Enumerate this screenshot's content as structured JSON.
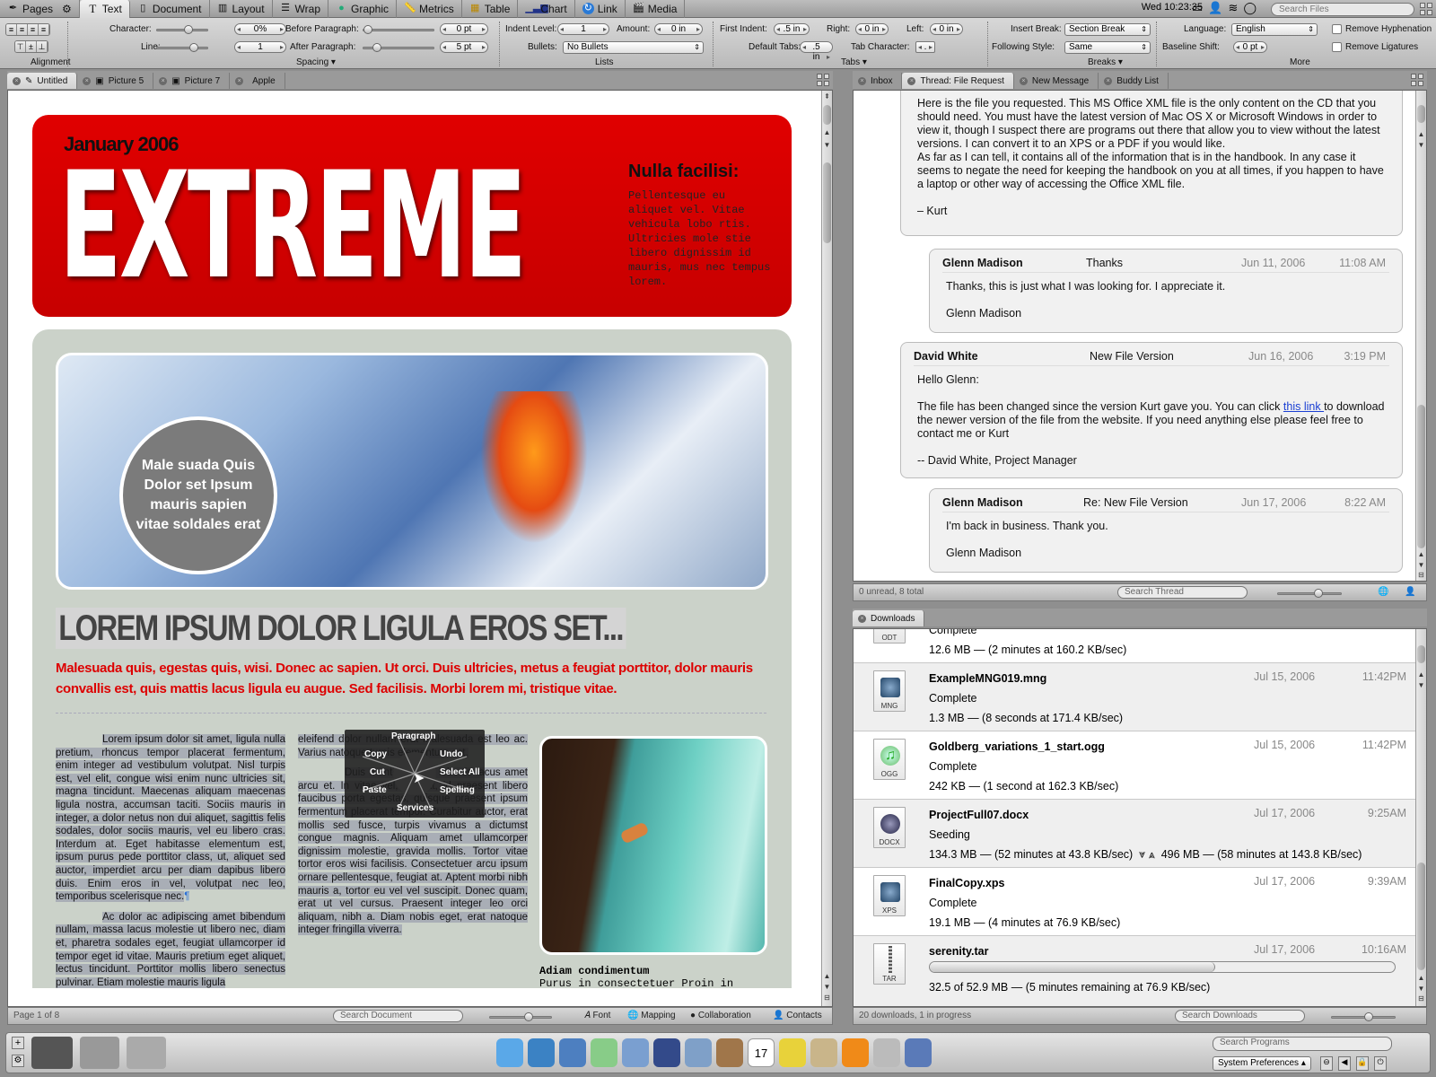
{
  "menubar": {
    "app_name": "Pages",
    "tabs": [
      {
        "label": "Text",
        "icon": "text-icon",
        "active": true
      },
      {
        "label": "Document",
        "icon": "document-icon"
      },
      {
        "label": "Layout",
        "icon": "layout-icon"
      },
      {
        "label": "Wrap",
        "icon": "wrap-icon"
      },
      {
        "label": "Graphic",
        "icon": "graphic-icon"
      },
      {
        "label": "Metrics",
        "icon": "ruler-icon"
      },
      {
        "label": "Table",
        "icon": "table-icon"
      },
      {
        "label": "Chart",
        "icon": "chart-icon"
      },
      {
        "label": "Link",
        "icon": "link-icon"
      },
      {
        "label": "Media",
        "icon": "media-icon"
      }
    ],
    "clock": "Wed 10:23:35",
    "search_placeholder": "Search Files"
  },
  "toolbar": {
    "alignment_label": "Alignment",
    "spacing_label": "Spacing",
    "lists_label": "Lists",
    "tabs_label": "Tabs",
    "breaks_label": "Breaks",
    "more_label": "More",
    "character_label": "Character:",
    "character_value": "0%",
    "line_label": "Line:",
    "line_value": "1",
    "before_paragraph_label": "Before Paragraph:",
    "before_paragraph_value": "0 pt",
    "after_paragraph_label": "After Paragraph:",
    "after_paragraph_value": "5 pt",
    "indent_level_label": "Indent Level:",
    "indent_level_value": "1",
    "amount_label": "Amount:",
    "amount_value": "0 in",
    "bullets_label": "Bullets:",
    "bullets_value": "No Bullets",
    "first_indent_label": "First Indent:",
    "first_indent_value": ".5 in",
    "right_label": "Right:",
    "right_value": "0 in",
    "left_label": "Left:",
    "left_value": "0 in",
    "default_tabs_label": "Default Tabs:",
    "default_tabs_value": ".5 in",
    "tab_character_label": "Tab Character:",
    "tab_character_value": ".",
    "insert_break_label": "Insert Break:",
    "insert_break_value": "Section Break",
    "following_style_label": "Following Style:",
    "following_style_value": "Same",
    "language_label": "Language:",
    "language_value": "English",
    "baseline_shift_label": "Baseline Shift:",
    "baseline_shift_value": "0 pt",
    "remove_hyphenation_label": "Remove Hyphenation",
    "remove_ligatures_label": "Remove Ligatures"
  },
  "doc_tabs": [
    {
      "label": "Untitled",
      "active": true
    },
    {
      "label": "Picture 5"
    },
    {
      "label": "Picture 7"
    },
    {
      "label": "Apple"
    }
  ],
  "mail_tabs": [
    {
      "label": "Inbox"
    },
    {
      "label": "Thread: File Request",
      "active": true
    },
    {
      "label": "New Message"
    },
    {
      "label": "Buddy List"
    }
  ],
  "downloads_tab": {
    "label": "Downloads"
  },
  "document": {
    "date": "January 2006",
    "masthead": "EXTREME",
    "sidebar_title": "Nulla facilisi:",
    "sidebar_text": "Pellentesque eu aliquet vel. Vitae vehicula lobo rtis. Ultricies mole stie libero dignissim id mauris, mus nec tempus lorem.",
    "circle_text": "Male suada Quis Dolor set Ipsum mauris sapien vitae soldales erat",
    "headline": "LOREM IPSUM DOLOR LIGULA EROS SET...",
    "subhead": "Malesuada quis, egestas quis, wisi. Donec ac sapien. Ut orci. Duis ultricies, metus a feugiat porttitor, dolor mauris convallis est, quis mattis lacus ligula eu augue. Sed facilisis. Morbi lorem mi, tristique vitae.",
    "col1_p1": "Lorem ipsum dolor sit amet, ligula nulla pretium, rhoncus tempor placerat fermentum, enim integer ad vestibulum volutpat. Nisl turpis est, vel elit, congue wisi enim nunc ultricies sit, magna tincidunt. Maecenas aliquam maecenas ligula nostra, accumsan taciti. Sociis mauris in integer, a dolor netus non dui aliquet, sagittis felis sodales, dolor sociis mauris, vel eu libero cras. Interdum at. Eget habitasse elementum est, ipsum purus pede porttitor class, ut, aliquet sed auctor, imperdiet arcu per diam dapibus libero duis. Enim eros in vel, volutpat nec leo, temporibus scelerisque nec.",
    "col1_p2": "Ac dolor ac adipiscing amet bibendum nullam, massa lacus molestie ut libero nec, diam et, pharetra sodales eget, feugiat ullamcorper id tempor eget id vitae. Mauris pretium eget aliquet, lectus tincidunt. Porttitor mollis libero senectus pulvinar. Etiam molestie mauris ligula",
    "col2_p1": "eleifend dolor nullam erat malesuada est leo ac. Varius natoque turpis elementum est.",
    "col2_p2": "Duis montes, tellus lobortis lacus amet arcu et. In vitae vel, wisi at, id praesent libero faucibus porta egestas, quisque praesent ipsum fermentum placerat tempor. Curabitur auctor, erat mollis sed fusce, turpis vivamus a dictumst congue magnis. Aliquam amet ullamcorper dignissim molestie, gravida mollis. Tortor vitae tortor eros wisi facilisis. Consectetuer arcu ipsum ornare pellentesque, feugiat at. Aptent morbi nibh mauris a, tortor eu vel vel suscipit. Donec quam, erat ut vel cursus. Praesent integer leo orci aliquam, nibh a. Diam nobis eget, erat natoque integer fringilla viverra.",
    "caption_title": "Adiam condimentum",
    "caption_text": "Purus in consectetuer Proin in",
    "pilcrow": "¶"
  },
  "pie_menu": {
    "top": "Paragraph",
    "left": [
      "Copy",
      "Cut",
      "Paste"
    ],
    "right": [
      "Undo",
      "Select All",
      "Spelling"
    ],
    "bottom": "Services"
  },
  "doc_status": {
    "page_info": "Page 1 of 8",
    "search_placeholder": "Search Document",
    "font_label": "Font",
    "mapping_label": "Mapping",
    "collaboration_label": "Collaboration",
    "contacts_label": "Contacts"
  },
  "mail": {
    "messages": [
      {
        "body_p1": "Here is the file you requested. This MS Office XML file  is the only content on the CD that you should need. You must have the latest version of Mac OS X or Microsoft Windows in order to view it, though I suspect there are programs out there that allow you to view without the latest versions. I can convert it to an XPS or a PDF if you would like.",
        "body_p2": "As far as I can tell, it contains all of the information that is in the handbook. In any case it seems to negate the need for keeping the handbook on you at all times, if you happen to have a laptop or other way of accessing the Office XML file.",
        "signature": "– Kurt"
      },
      {
        "from": "Glenn Madison",
        "subject": "Thanks",
        "date": "Jun 11, 2006",
        "time": "11:08 AM",
        "body": "Thanks, this is just what I was looking for. I appreciate it.",
        "signature": "Glenn Madison"
      },
      {
        "from": "David White",
        "subject": "New File Version",
        "date": "Jun 16, 2006",
        "time": "3:19 PM",
        "greeting": "Hello Glenn:",
        "body_before_link": "The file has been changed since the version Kurt gave you. You can click ",
        "link_text": "this link ",
        "body_after_link": "to download the newer version of the file from the website. If you need anything else please feel free to contact me or Kurt",
        "signature": "-- David White, Project Manager"
      },
      {
        "from": "Glenn Madison",
        "subject": "Re: New File Version",
        "date": "Jun 17, 2006",
        "time": "8:22 AM",
        "body": "I'm back in business.  Thank you.",
        "signature": "Glenn Madison"
      }
    ],
    "status": "0 unread, 8 total",
    "search_placeholder": "Search Thread"
  },
  "downloads": {
    "items": [
      {
        "name": "",
        "status": "Complete",
        "size": "12.6 MB — (2 minutes at 160.2 KB/sec)",
        "ext": "ODT",
        "date": "",
        "time": ""
      },
      {
        "name": "ExampleMNG019.mng",
        "status": "Complete",
        "size": "1.3 MB — (8 seconds at 171.4 KB/sec)",
        "ext": "MNG",
        "date": "Jul 15, 2006",
        "time": "11:42PM"
      },
      {
        "name": "Goldberg_variations_1_start.ogg",
        "status": "Complete",
        "size": "242 KB — (1 second at 162.3 KB/sec)",
        "ext": "OGG",
        "date": "Jul 15, 2006",
        "time": "11:42PM"
      },
      {
        "name": "ProjectFull07.docx",
        "status": "Seeding",
        "size": "134.3 MB — (52 minutes at 43.8 KB/sec)",
        "upload": "496 MB — (58 minutes at 143.8 KB/sec)",
        "ext": "DOCX",
        "date": "Jul 17, 2006",
        "time": "9:25AM"
      },
      {
        "name": "FinalCopy.xps",
        "status": "Complete",
        "size": "19.1 MB — (4 minutes at 76.9 KB/sec)",
        "ext": "XPS",
        "date": "Jul 17, 2006",
        "time": "9:39AM"
      },
      {
        "name": "serenity.tar",
        "status": "",
        "size": "32.5 of 52.9 MB — (5 minutes remaining at 76.9 KB/sec)",
        "ext": "TAR",
        "date": "Jul 17, 2006",
        "time": "10:16AM",
        "progress": 0.614
      }
    ],
    "status": "20 downloads, 1 in progress",
    "search_placeholder": "Search Downloads"
  },
  "dock": {
    "search_placeholder": "Search Programs",
    "system_preferences_label": "System Preferences",
    "apps": [
      "spotlight-icon",
      "safari-icon",
      "preview-icon",
      "itunes-icon",
      "imovie-icon",
      "pages-icon",
      "keynote-icon",
      "iphoto-icon",
      "ical-icon",
      "ichat-icon",
      "address-book-icon",
      "vlc-icon",
      "utilities-icon",
      "iphoto-library-icon"
    ],
    "calendar_day": "17"
  }
}
